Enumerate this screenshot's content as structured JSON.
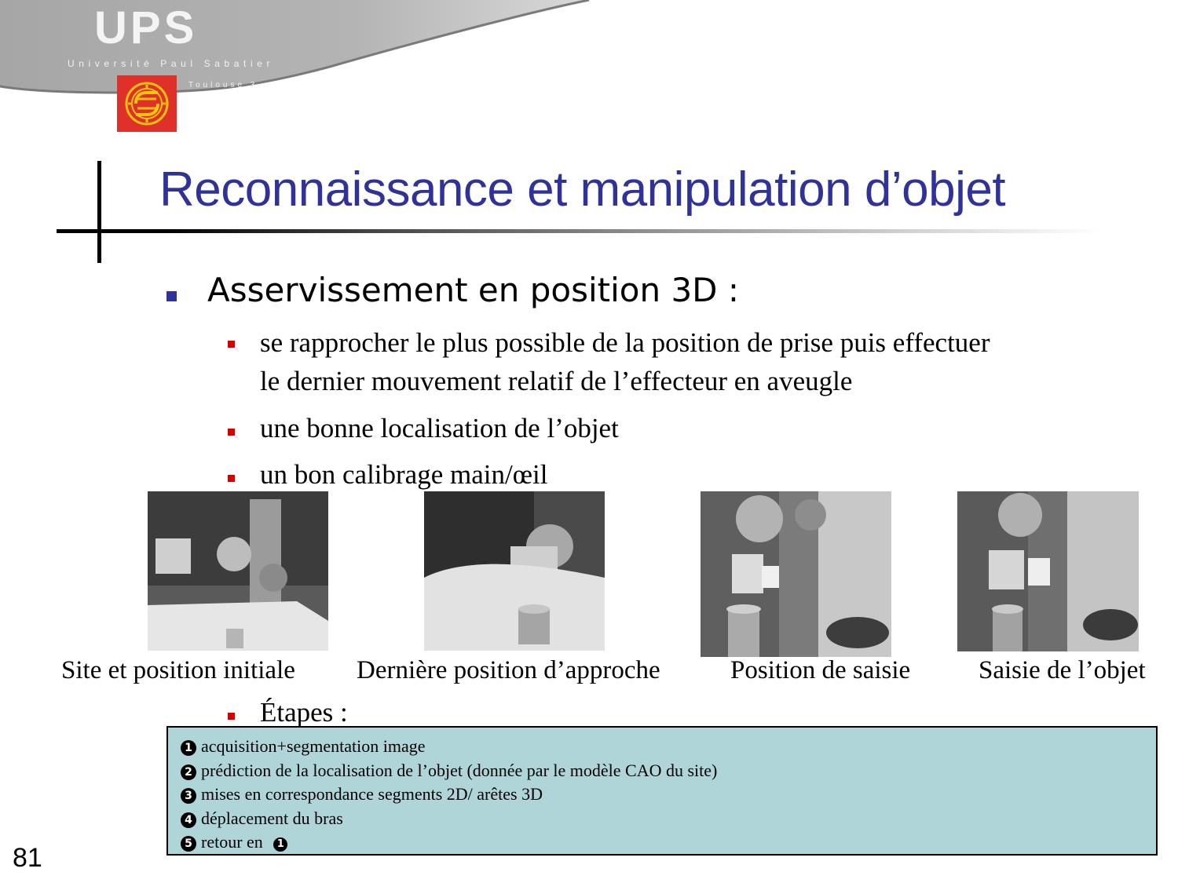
{
  "header": {
    "logo_main": "UPS",
    "logo_university": "Université Paul Sabatier",
    "logo_city": "Toulouse 3",
    "brand_colors": {
      "seal_red": "#e0302a",
      "seal_gold": "#f1c40f",
      "swoosh_gray": "#a9a9a9"
    }
  },
  "slide": {
    "title": "Reconnaissance et manipulation d’objet",
    "title_color": "#2f3299",
    "bullet_main": "Asservissement en position 3D :",
    "sub_bullets": [
      "se rapprocher le plus possible de la position de prise puis effectuer",
      "le dernier mouvement relatif de l’effecteur en aveugle",
      "une bonne localisation de l’objet",
      "un bon calibrage main/œil"
    ],
    "captions": [
      "Site et position initiale",
      "Dernière position d’approche",
      "Position de saisie",
      "Saisie de l’objet"
    ],
    "steps_heading": "Étapes :",
    "steps": [
      {
        "num": "1",
        "text": "acquisition+segmentation image"
      },
      {
        "num": "2",
        "text": "prédiction de la localisation de l’objet (donnée par le modèle CAO du site)"
      },
      {
        "num": "3",
        "text": "mises en correspondance segments 2D/ arêtes 3D"
      },
      {
        "num": "4",
        "text": "déplacement du bras"
      },
      {
        "num": "5",
        "text": "retour en "
      }
    ],
    "steps_return_num": "1",
    "steps_box_color": "#b0d5d9",
    "page_number": "81"
  }
}
